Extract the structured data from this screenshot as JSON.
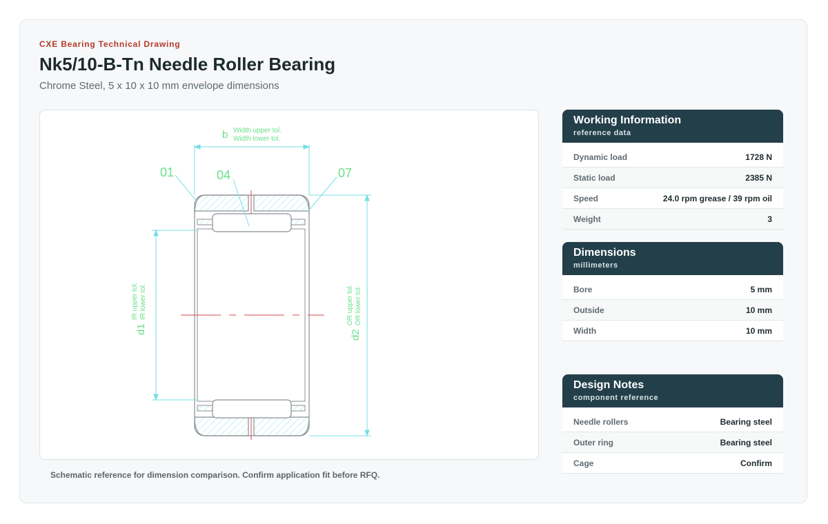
{
  "header": {
    "eyebrow": "CXE Bearing Technical Drawing",
    "title": "Nk5/10-B-Tn Needle Roller Bearing",
    "subtitle": "Chrome Steel, 5 x 10 x 10 mm envelope dimensions"
  },
  "drawing": {
    "labels": {
      "b": "b",
      "width_upper": "Width upper tol.",
      "width_lower": "Width lower tol.",
      "c01": "01",
      "c04": "04",
      "c07": "07",
      "d1": "d1",
      "ir_upper": "IR upper tol.",
      "ir_lower": "IR lower tol.",
      "d2": "d2",
      "or_upper": "OR upper tol.",
      "or_lower": "OR lower tol."
    },
    "colors": {
      "outline": "#8a8f92",
      "dimension": "#76dfe6",
      "label": "#69e08a",
      "centerline": "#d64b4b"
    },
    "caption": "Schematic reference for dimension comparison. Confirm application fit before RFQ."
  },
  "panels": [
    {
      "title": "Working Information",
      "subtitle": "reference data",
      "rows": [
        {
          "label": "Dynamic load",
          "value": "1728 N"
        },
        {
          "label": "Static load",
          "value": "2385 N"
        },
        {
          "label": "Speed",
          "value": "24.0 rpm grease / 39 rpm oil"
        },
        {
          "label": "Weight",
          "value": "3"
        }
      ]
    },
    {
      "title": "Dimensions",
      "subtitle": "millimeters",
      "rows": [
        {
          "label": "Bore",
          "value": "5 mm"
        },
        {
          "label": "Outside",
          "value": "10 mm"
        },
        {
          "label": "Width",
          "value": "10 mm"
        }
      ]
    },
    {
      "title": "Design Notes",
      "subtitle": "component reference",
      "rows": [
        {
          "label": "Needle rollers",
          "value": "Bearing steel"
        },
        {
          "label": "Outer ring",
          "value": "Bearing steel"
        },
        {
          "label": "Cage",
          "value": "Confirm"
        }
      ]
    }
  ],
  "theme": {
    "accent": "#b5392b",
    "panel_header": "#233f49"
  }
}
